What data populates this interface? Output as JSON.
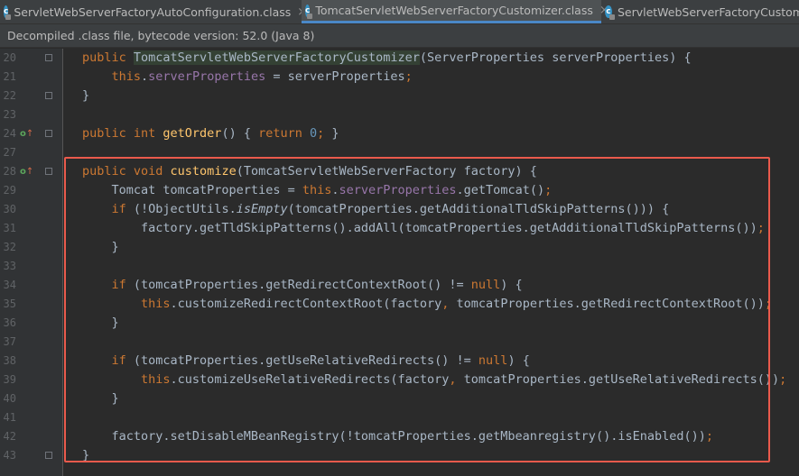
{
  "tabs": [
    {
      "label": "ServletWebServerFactoryAutoConfiguration.class",
      "icon": "class-file-icon",
      "active": false
    },
    {
      "label": "TomcatServletWebServerFactoryCustomizer.class",
      "icon": "class-file-icon",
      "active": true
    },
    {
      "label": "ServletWebServerFactoryCustomiz",
      "icon": "class-file-icon",
      "active": false
    }
  ],
  "close_glyph": "×",
  "banner": "Decompiled .class file, bytecode version: 52.0 (Java 8)",
  "colors": {
    "keyword": "#cc7832",
    "field": "#9876aa",
    "method": "#ffc66d",
    "number": "#6897bb",
    "text": "#a9b7c6",
    "highlight_box": "#ea5a4c"
  },
  "lines": [
    {
      "n": "20",
      "tokens": [
        [
          "kw",
          "public "
        ],
        [
          "hl",
          "TomcatServletWebServerFactoryCustomizer"
        ],
        [
          "t",
          "(ServerProperties serverProperties) {"
        ]
      ]
    },
    {
      "n": "21",
      "tokens": [
        [
          "t",
          "    "
        ],
        [
          "kw",
          "this"
        ],
        [
          "t",
          "."
        ],
        [
          "fld",
          "serverProperties"
        ],
        [
          "t",
          " = serverProperties"
        ],
        [
          "kw",
          ";"
        ]
      ]
    },
    {
      "n": "22",
      "tokens": [
        [
          "t",
          "}"
        ]
      ]
    },
    {
      "n": "23",
      "tokens": []
    },
    {
      "n": "24",
      "tokens": [
        [
          "kw",
          "public int "
        ],
        [
          "fn",
          "getOrder"
        ],
        [
          "t",
          "() { "
        ],
        [
          "kw",
          "return "
        ],
        [
          "num",
          "0"
        ],
        [
          "kw",
          ";"
        ],
        [
          "t",
          " }"
        ]
      ]
    },
    {
      "n": "27",
      "tokens": []
    },
    {
      "n": "28",
      "tokens": [
        [
          "kw",
          "public void "
        ],
        [
          "fn",
          "customize"
        ],
        [
          "t",
          "(TomcatServletWebServerFactory factory) {"
        ]
      ]
    },
    {
      "n": "29",
      "tokens": [
        [
          "t",
          "    Tomcat tomcatProperties = "
        ],
        [
          "kw",
          "this"
        ],
        [
          "t",
          "."
        ],
        [
          "fld",
          "serverProperties"
        ],
        [
          "t",
          ".getTomcat()"
        ],
        [
          "kw",
          ";"
        ]
      ]
    },
    {
      "n": "30",
      "tokens": [
        [
          "t",
          "    "
        ],
        [
          "kw",
          "if "
        ],
        [
          "t",
          "(!ObjectUtils."
        ],
        [
          "it",
          "isEmpty"
        ],
        [
          "t",
          "(tomcatProperties.getAdditionalTldSkipPatterns())) {"
        ]
      ]
    },
    {
      "n": "31",
      "tokens": [
        [
          "t",
          "        factory.getTldSkipPatterns().addAll(tomcatProperties.getAdditionalTldSkipPatterns())"
        ],
        [
          "kw",
          ";"
        ]
      ]
    },
    {
      "n": "32",
      "tokens": [
        [
          "t",
          "    }"
        ]
      ]
    },
    {
      "n": "33",
      "tokens": []
    },
    {
      "n": "34",
      "tokens": [
        [
          "t",
          "    "
        ],
        [
          "kw",
          "if "
        ],
        [
          "t",
          "(tomcatProperties.getRedirectContextRoot() != "
        ],
        [
          "kw",
          "null"
        ],
        [
          "t",
          ") {"
        ]
      ]
    },
    {
      "n": "35",
      "tokens": [
        [
          "t",
          "        "
        ],
        [
          "kw",
          "this"
        ],
        [
          "t",
          ".customizeRedirectContextRoot(factory"
        ],
        [
          "kw",
          ", "
        ],
        [
          "t",
          "tomcatProperties.getRedirectContextRoot())"
        ],
        [
          "kw",
          ";"
        ]
      ]
    },
    {
      "n": "36",
      "tokens": [
        [
          "t",
          "    }"
        ]
      ]
    },
    {
      "n": "37",
      "tokens": []
    },
    {
      "n": "38",
      "tokens": [
        [
          "t",
          "    "
        ],
        [
          "kw",
          "if "
        ],
        [
          "t",
          "(tomcatProperties.getUseRelativeRedirects() != "
        ],
        [
          "kw",
          "null"
        ],
        [
          "t",
          ") {"
        ]
      ]
    },
    {
      "n": "39",
      "tokens": [
        [
          "t",
          "        "
        ],
        [
          "kw",
          "this"
        ],
        [
          "t",
          ".customizeUseRelativeRedirects(factory"
        ],
        [
          "kw",
          ", "
        ],
        [
          "t",
          "tomcatProperties.getUseRelativeRedirects())"
        ],
        [
          "kw",
          ";"
        ]
      ]
    },
    {
      "n": "40",
      "tokens": [
        [
          "t",
          "    }"
        ]
      ]
    },
    {
      "n": "41",
      "tokens": []
    },
    {
      "n": "42",
      "tokens": [
        [
          "t",
          "    factory.setDisableMBeanRegistry(!tomcatProperties.getMbeanregistry().isEnabled())"
        ],
        [
          "kw",
          ";"
        ]
      ]
    },
    {
      "n": "43",
      "tokens": [
        [
          "t",
          "}"
        ]
      ]
    }
  ]
}
